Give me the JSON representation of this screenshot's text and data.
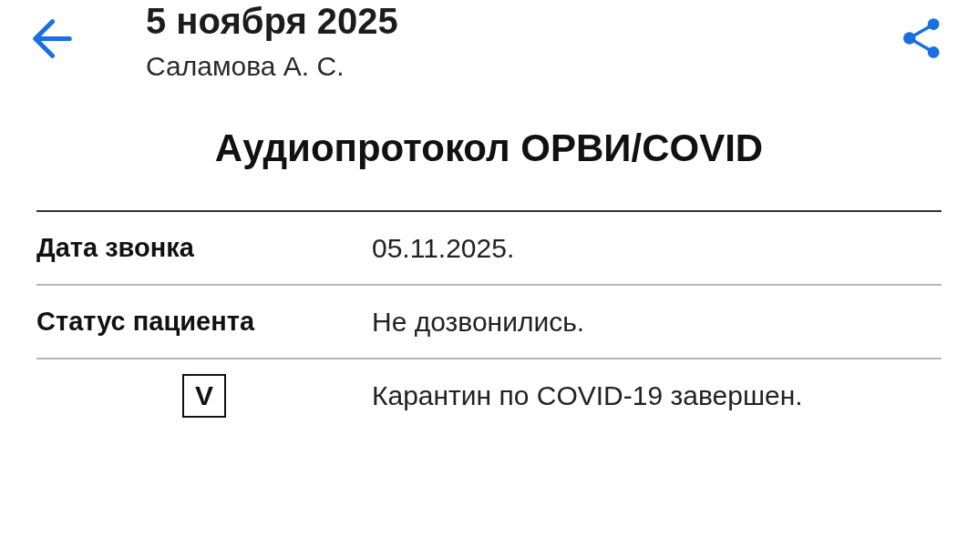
{
  "header": {
    "title": "5 ноября 2025",
    "subtitle": "Саламова А. С."
  },
  "document": {
    "title": "Аудиопротокол ОРВИ/COVID",
    "rows": [
      {
        "kind": "field",
        "label": "Дата звонка",
        "value": "05.11.2025."
      },
      {
        "kind": "field",
        "label": "Статус пациента",
        "value": "Не дозвонились."
      },
      {
        "kind": "mark",
        "mark": "V",
        "checked": true,
        "value": "Карантин по COVID-19 завершен."
      }
    ]
  }
}
